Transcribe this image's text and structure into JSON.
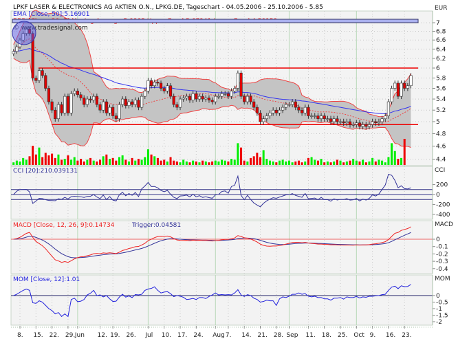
{
  "chart_data": {
    "type": "candlestick",
    "title": "LPKF LASER & ELECTRONICS AG AKTIEN O.N., LPKG.DE, Tageschart - 04.05.2006 - 25.10.2006 - 5.85",
    "copyright": "© www.tradesignal.com",
    "currency_label": "EUR",
    "scale": "log",
    "legend": {
      "ema": "EMA [Close, 50]:5.16901",
      "bbd": "BBD [Close, 20, 2] Moving Average:5.0905 Upper Band:5.67941 Lower Band:4.50159",
      "cci": "CCI [20]:210.039131",
      "macd": "MACD [Close, 12, 26, 9]:0.14734",
      "macd_trigger": "Trigger:0.04581",
      "mom": "MOM [Close, 12]:1.01"
    },
    "close": [
      6.35,
      6.45,
      6.6,
      6.75,
      6.85,
      6.75,
      5.8,
      5.75,
      5.95,
      5.85,
      5.6,
      5.35,
      5.2,
      5.05,
      5.3,
      5.15,
      5.45,
      5.15,
      5.5,
      5.55,
      5.48,
      5.42,
      5.3,
      5.4,
      5.38,
      5.45,
      5.3,
      5.2,
      5.35,
      5.15,
      5.25,
      5.1,
      5.05,
      5.3,
      5.4,
      5.28,
      5.35,
      5.3,
      5.38,
      5.25,
      5.45,
      5.55,
      5.75,
      5.65,
      5.72,
      5.7,
      5.6,
      5.55,
      5.65,
      5.45,
      5.3,
      5.25,
      5.4,
      5.42,
      5.45,
      5.38,
      5.5,
      5.4,
      5.45,
      5.4,
      5.42,
      5.38,
      5.35,
      5.45,
      5.45,
      5.5,
      5.5,
      5.45,
      5.55,
      5.6,
      5.9,
      5.45,
      5.35,
      5.45,
      5.35,
      5.25,
      5.15,
      5.0,
      5.05,
      5.1,
      5.15,
      5.2,
      5.15,
      5.2,
      5.25,
      5.3,
      5.3,
      5.35,
      5.25,
      5.2,
      5.15,
      5.25,
      5.1,
      5.1,
      5.1,
      5.05,
      5.1,
      5.05,
      5.05,
      5.0,
      5.05,
      5.0,
      5.0,
      4.98,
      5.0,
      4.95,
      4.95,
      4.98,
      4.92,
      4.95,
      4.92,
      4.95,
      5.0,
      4.98,
      5.0,
      5.05,
      5.1,
      5.35,
      5.6,
      5.7,
      5.45,
      5.7,
      5.6,
      5.65,
      5.85
    ],
    "volume": [
      3,
      5,
      4,
      8,
      6,
      10,
      22,
      12,
      20,
      9,
      14,
      11,
      13,
      8,
      12,
      6,
      7,
      11,
      6,
      9,
      5,
      7,
      4,
      6,
      8,
      5,
      4,
      6,
      10,
      12,
      7,
      8,
      5,
      9,
      11,
      6,
      4,
      8,
      5,
      7,
      6,
      9,
      18,
      12,
      10,
      8,
      5,
      6,
      4,
      9,
      5,
      4,
      3,
      6,
      4,
      3,
      5,
      4,
      3,
      5,
      4,
      3,
      4,
      5,
      4,
      6,
      5,
      4,
      7,
      6,
      25,
      20,
      5,
      4,
      8,
      10,
      14,
      9,
      17,
      7,
      5,
      4,
      3,
      5,
      6,
      4,
      5,
      3,
      4,
      5,
      3,
      4,
      8,
      9,
      6,
      5,
      7,
      3,
      4,
      3,
      4,
      6,
      5,
      3,
      4,
      5,
      7,
      5,
      4,
      6,
      3,
      4,
      8,
      4,
      6,
      5,
      3,
      9,
      25,
      16,
      7,
      8,
      30
    ],
    "up_color": "#ffffff",
    "down_color": "#e00000",
    "volume_up_color": "#00ee00",
    "volume_down_color": "#ee0000",
    "support_resistance": [
      6.0,
      4.95
    ],
    "x_labels": [
      {
        "label": "8.",
        "day": 2
      },
      {
        "label": "15.",
        "day": 7
      },
      {
        "label": "22.",
        "day": 12
      },
      {
        "label": "29.",
        "day": 17
      },
      {
        "label": "Jun",
        "day": 20
      },
      {
        "label": "12.",
        "day": 27
      },
      {
        "label": "19.",
        "day": 31
      },
      {
        "label": "26.",
        "day": 36
      },
      {
        "label": "Jul",
        "day": 42
      },
      {
        "label": "10.",
        "day": 47
      },
      {
        "label": "17.",
        "day": 52
      },
      {
        "label": "24.",
        "day": 57
      },
      {
        "label": "Aug",
        "day": 63
      },
      {
        "label": "7.",
        "day": 67
      },
      {
        "label": "14.",
        "day": 72
      },
      {
        "label": "21.",
        "day": 77
      },
      {
        "label": "28.",
        "day": 82
      },
      {
        "label": "Sep",
        "day": 86
      },
      {
        "label": "11.",
        "day": 92
      },
      {
        "label": "18.",
        "day": 97
      },
      {
        "label": "25.",
        "day": 102
      },
      {
        "label": "Oct",
        "day": 107
      },
      {
        "label": "9.",
        "day": 112
      },
      {
        "label": "16.",
        "day": 117
      },
      {
        "label": "23.",
        "day": 122
      }
    ],
    "month_starts": [
      20,
      42,
      63,
      86,
      107
    ],
    "panels": {
      "price": {
        "label": "EUR",
        "ticks": [
          7,
          6.8,
          6.6,
          6.4,
          6.2,
          6,
          5.8,
          5.6,
          5.4,
          5.2,
          5,
          4.8,
          4.6,
          4.4
        ]
      },
      "cci": {
        "label": "CCI",
        "ticks": [
          200,
          0,
          -200,
          -400
        ],
        "levels": [
          100,
          0,
          -100
        ]
      },
      "macd": {
        "label": "MACD",
        "ticks": [
          0,
          -0.1,
          -0.2,
          -0.3,
          -0.4
        ],
        "ylim": [
          -0.45,
          0.2
        ]
      },
      "mom": {
        "label": "MOM",
        "ticks": [
          0,
          -0.5,
          -1,
          -1.5,
          -2
        ],
        "ylim": [
          -2.1,
          1.6
        ]
      }
    }
  }
}
